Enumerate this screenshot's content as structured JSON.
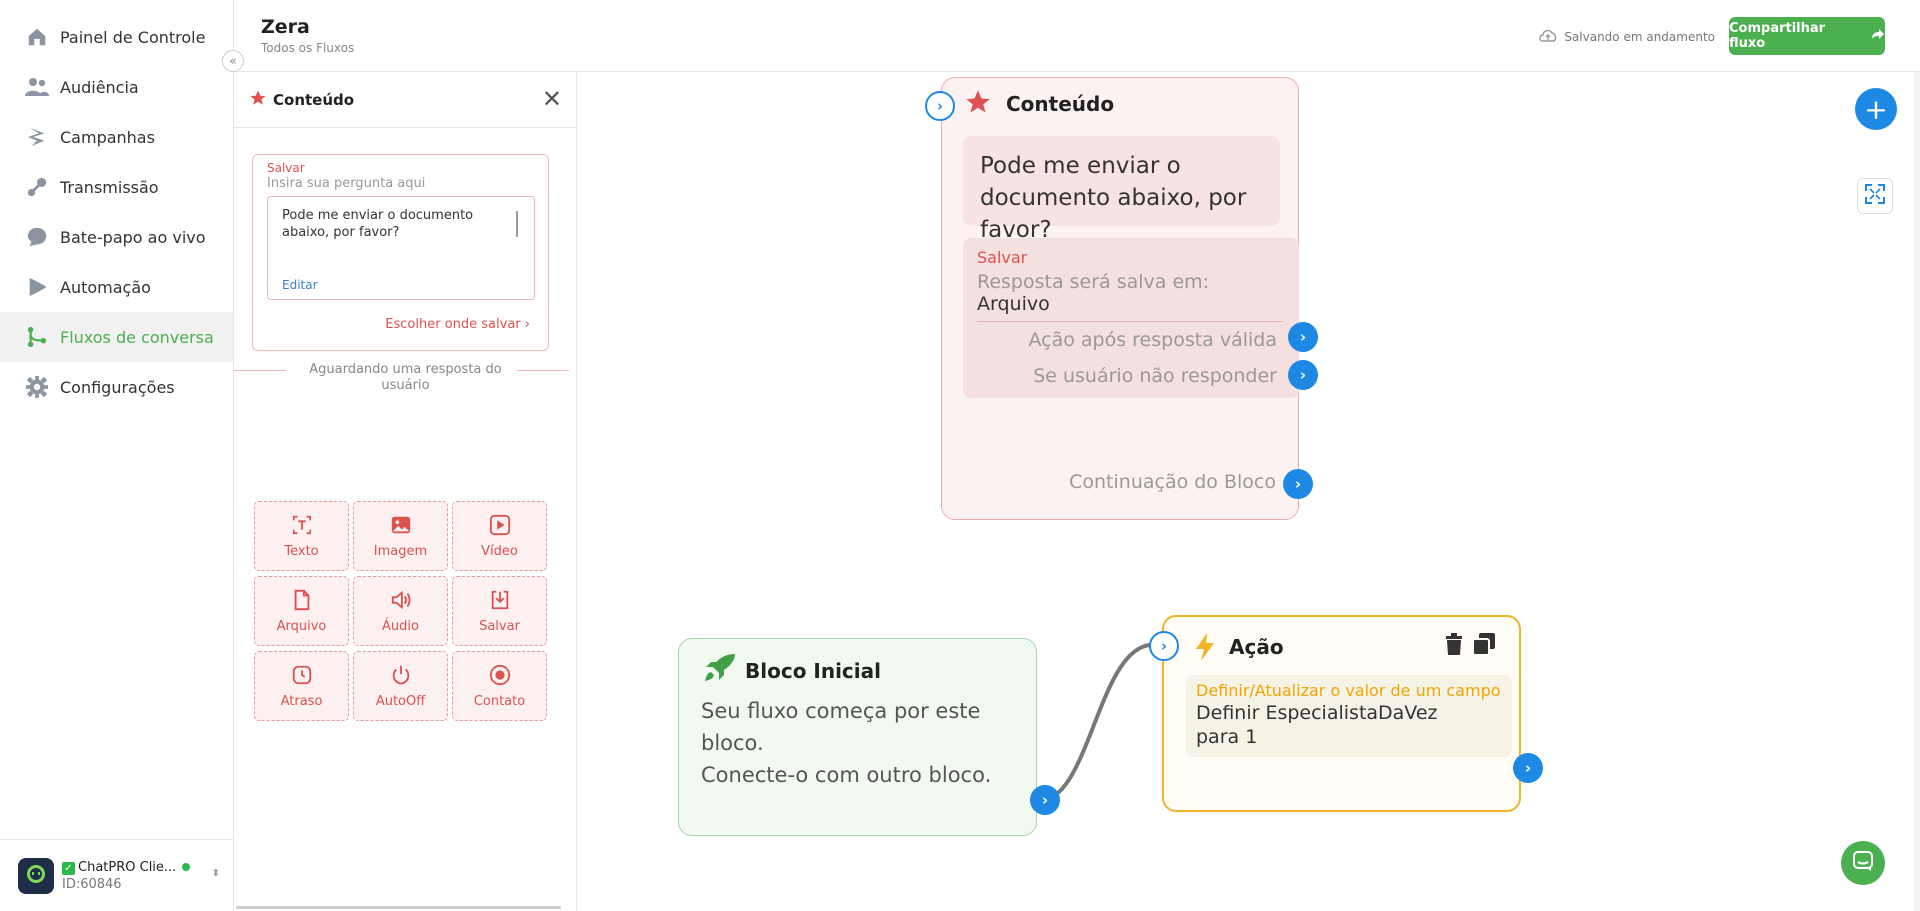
{
  "nav": {
    "items": [
      {
        "label": "Painel de Controle",
        "icon": "home-icon"
      },
      {
        "label": "Audiência",
        "icon": "users-icon"
      },
      {
        "label": "Campanhas",
        "icon": "bolt-icon"
      },
      {
        "label": "Transmissão",
        "icon": "broadcast-icon"
      },
      {
        "label": "Bate-papo ao vivo",
        "icon": "chat-icon"
      },
      {
        "label": "Automação",
        "icon": "play-icon"
      },
      {
        "label": "Fluxos de conversa",
        "icon": "flow-icon",
        "active": true
      },
      {
        "label": "Configurações",
        "icon": "gear-icon"
      }
    ],
    "collapse": "«",
    "account": {
      "name": "ChatPRO Clie...",
      "id": "ID:60846",
      "logo": "ChatPRO"
    }
  },
  "header": {
    "title": "Zera",
    "breadcrumb": "Todos os Fluxos",
    "saving": "Salvando em andamento",
    "share": "Compartilhar fluxo"
  },
  "panel": {
    "title": "Conteúdo",
    "close": "✕",
    "save_label": "Salvar",
    "question_placeholder": "Insira sua pergunta aqui",
    "message": "Pode me enviar o documento abaixo, por favor?",
    "edit": "Editar",
    "choose_save": "Escolher onde salvar",
    "waiting": "Aguardando uma resposta do usuário",
    "tiles": [
      {
        "label": "Texto",
        "icon": "text-icon"
      },
      {
        "label": "Imagem",
        "icon": "image-icon"
      },
      {
        "label": "Vídeo",
        "icon": "video-icon"
      },
      {
        "label": "Arquivo",
        "icon": "file-icon"
      },
      {
        "label": "Áudio",
        "icon": "audio-icon"
      },
      {
        "label": "Salvar",
        "icon": "download-icon"
      },
      {
        "label": "Atraso",
        "icon": "clock-icon"
      },
      {
        "label": "AutoOff",
        "icon": "power-icon"
      },
      {
        "label": "Contato",
        "icon": "contact-icon"
      }
    ]
  },
  "canvas": {
    "content_node": {
      "title": "Conteúdo",
      "message": "Pode me enviar o documento abaixo, por favor?",
      "save_label": "Salvar",
      "saved_in": "Resposta será salva em:",
      "saved_value": "Arquivo",
      "after_valid": "Ação após resposta válida",
      "no_response": "Se usuário não responder",
      "continuation": "Continuação do Bloco"
    },
    "start_node": {
      "title": "Bloco Inicial",
      "description_1": "Seu fluxo começa por este bloco.",
      "description_2": "Conecte-o com outro bloco."
    },
    "action_node": {
      "title": "Ação",
      "field_label": "Definir/Atualizar o valor de um campo",
      "value_1": "Definir EspecialistaDaVez",
      "value_2": "para 1"
    },
    "add_button": "+"
  },
  "colors": {
    "accent_green": "#4caf50",
    "port_blue": "#1e88e5",
    "content_red": "#d9534f",
    "action_yellow": "#f0b429"
  }
}
